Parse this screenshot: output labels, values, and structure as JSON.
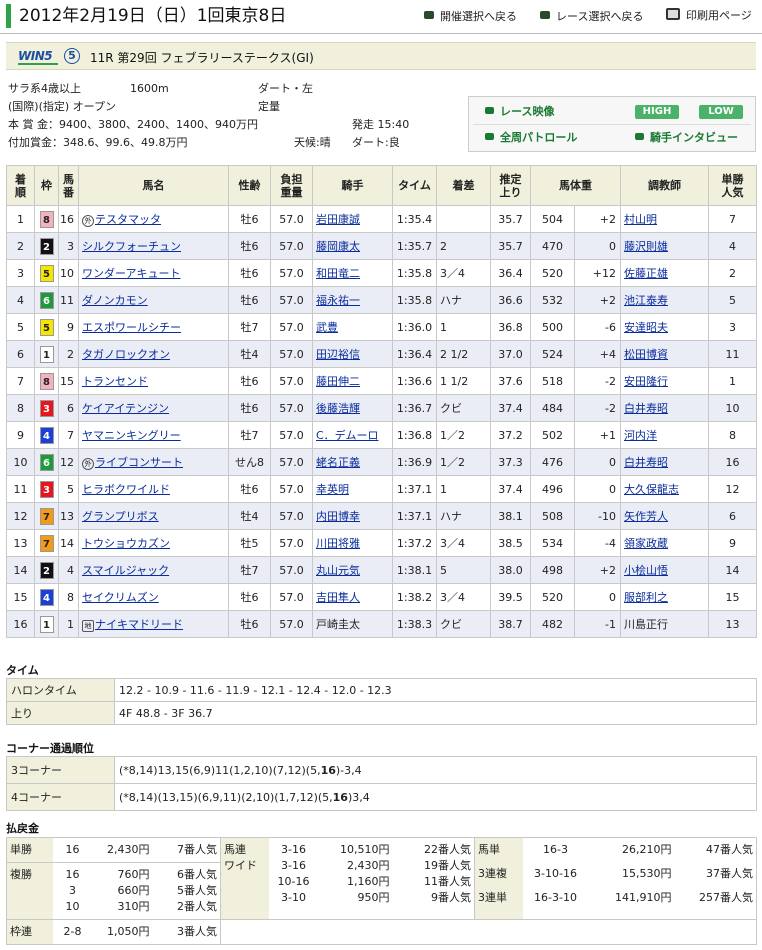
{
  "header": {
    "title": "2012年2月19日（日）1回東京8日",
    "links": {
      "kaisai": "開催選択へ戻る",
      "race": "レース選択へ戻る",
      "print": "印刷用ページ"
    }
  },
  "race_bar": {
    "logo": "WIN5",
    "win5_number": "⑤",
    "race_name": "11R 第29回 フェブラリーステークス(GI)"
  },
  "info": {
    "class": "サラ系4歳以上",
    "distance": "1600m",
    "surface": "ダート・左",
    "condition_label": "(国際)(指定) オープン",
    "weight_rule": "定量",
    "prize": "本 賞 金：9400、3800、2400、1400、940万円",
    "added_prize": "付加賞金：348.6、99.6、49.8万円",
    "post_time": "発走 15:40",
    "weather": "天候:晴",
    "track": "ダート:良"
  },
  "media": {
    "race_video": "レース映像",
    "high": "HIGH",
    "low": "LOW",
    "patrol": "全周パトロール",
    "interview": "騎手インタビュー"
  },
  "results_header": {
    "rank": [
      "着",
      "順"
    ],
    "waku": "枠",
    "num": [
      "馬",
      "番"
    ],
    "horse": "馬名",
    "sexage": "性齢",
    "weight": [
      "負担",
      "重量"
    ],
    "jockey": "騎手",
    "time": "タイム",
    "margin": "着差",
    "last3f": [
      "推定",
      "上り"
    ],
    "body": "馬体重",
    "trainer": "調教師",
    "pop": [
      "単勝",
      "人気"
    ]
  },
  "results": [
    {
      "rank": "1",
      "waku": "8",
      "num": "16",
      "mark": "外",
      "horse": "テスタマッタ",
      "sexage": "牡6",
      "weight": "57.0",
      "jockey": "岩田康誠",
      "time": "1:35.4",
      "margin": "",
      "last3f": "35.7",
      "body": "504",
      "diff": "+2",
      "trainer": "村山明",
      "pop": "7"
    },
    {
      "rank": "2",
      "waku": "2",
      "num": "3",
      "mark": "",
      "horse": "シルクフォーチュン",
      "sexage": "牡6",
      "weight": "57.0",
      "jockey": "藤岡康太",
      "time": "1:35.7",
      "margin": "2",
      "last3f": "35.7",
      "body": "470",
      "diff": "0",
      "trainer": "藤沢則雄",
      "pop": "4"
    },
    {
      "rank": "3",
      "waku": "5",
      "num": "10",
      "mark": "",
      "horse": "ワンダーアキュート",
      "sexage": "牡6",
      "weight": "57.0",
      "jockey": "和田竜二",
      "time": "1:35.8",
      "margin": "3／4",
      "last3f": "36.4",
      "body": "520",
      "diff": "+12",
      "trainer": "佐藤正雄",
      "pop": "2"
    },
    {
      "rank": "4",
      "waku": "6",
      "num": "11",
      "mark": "",
      "horse": "ダノンカモン",
      "sexage": "牡6",
      "weight": "57.0",
      "jockey": "福永祐一",
      "time": "1:35.8",
      "margin": "ハナ",
      "last3f": "36.6",
      "body": "532",
      "diff": "+2",
      "trainer": "池江泰寿",
      "pop": "5"
    },
    {
      "rank": "5",
      "waku": "5",
      "num": "9",
      "mark": "",
      "horse": "エスポワールシチー",
      "sexage": "牡7",
      "weight": "57.0",
      "jockey": "武豊",
      "time": "1:36.0",
      "margin": "1",
      "last3f": "36.8",
      "body": "500",
      "diff": "-6",
      "trainer": "安達昭夫",
      "pop": "3"
    },
    {
      "rank": "6",
      "waku": "1",
      "num": "2",
      "mark": "",
      "horse": "タガノロックオン",
      "sexage": "牡4",
      "weight": "57.0",
      "jockey": "田辺裕信",
      "time": "1:36.4",
      "margin": "2 1/2",
      "last3f": "37.0",
      "body": "524",
      "diff": "+4",
      "trainer": "松田博資",
      "pop": "11"
    },
    {
      "rank": "7",
      "waku": "8",
      "num": "15",
      "mark": "",
      "horse": "トランセンド",
      "sexage": "牡6",
      "weight": "57.0",
      "jockey": "藤田伸二",
      "time": "1:36.6",
      "margin": "1 1/2",
      "last3f": "37.6",
      "body": "518",
      "diff": "-2",
      "trainer": "安田隆行",
      "pop": "1"
    },
    {
      "rank": "8",
      "waku": "3",
      "num": "6",
      "mark": "",
      "horse": "ケイアイテンジン",
      "sexage": "牡6",
      "weight": "57.0",
      "jockey": "後藤浩輝",
      "time": "1:36.7",
      "margin": "クビ",
      "last3f": "37.4",
      "body": "484",
      "diff": "-2",
      "trainer": "白井寿昭",
      "pop": "10"
    },
    {
      "rank": "9",
      "waku": "4",
      "num": "7",
      "mark": "",
      "horse": "ヤマニンキングリー",
      "sexage": "牡7",
      "weight": "57.0",
      "jockey": "C．デムーロ",
      "time": "1:36.8",
      "margin": "1／2",
      "last3f": "37.2",
      "body": "502",
      "diff": "+1",
      "trainer": "河内洋",
      "pop": "8"
    },
    {
      "rank": "10",
      "waku": "6",
      "num": "12",
      "mark": "外",
      "horse": "ライブコンサート",
      "sexage": "せん8",
      "weight": "57.0",
      "jockey": "蛯名正義",
      "time": "1:36.9",
      "margin": "1／2",
      "last3f": "37.3",
      "body": "476",
      "diff": "0",
      "trainer": "白井寿昭",
      "pop": "16"
    },
    {
      "rank": "11",
      "waku": "3",
      "num": "5",
      "mark": "",
      "horse": "ヒラボクワイルド",
      "sexage": "牡6",
      "weight": "57.0",
      "jockey": "幸英明",
      "time": "1:37.1",
      "margin": "1",
      "last3f": "37.4",
      "body": "496",
      "diff": "0",
      "trainer": "大久保龍志",
      "pop": "12"
    },
    {
      "rank": "12",
      "waku": "7",
      "num": "13",
      "mark": "",
      "horse": "グランプリボス",
      "sexage": "牡4",
      "weight": "57.0",
      "jockey": "内田博幸",
      "time": "1:37.1",
      "margin": "ハナ",
      "last3f": "38.1",
      "body": "508",
      "diff": "-10",
      "trainer": "矢作芳人",
      "pop": "6"
    },
    {
      "rank": "13",
      "waku": "7",
      "num": "14",
      "mark": "",
      "horse": "トウショウカズン",
      "sexage": "牡5",
      "weight": "57.0",
      "jockey": "川田将雅",
      "time": "1:37.2",
      "margin": "3／4",
      "last3f": "38.5",
      "body": "534",
      "diff": "-4",
      "trainer": "領家政蔵",
      "pop": "9"
    },
    {
      "rank": "14",
      "waku": "2",
      "num": "4",
      "mark": "",
      "horse": "スマイルジャック",
      "sexage": "牡7",
      "weight": "57.0",
      "jockey": "丸山元気",
      "time": "1:38.1",
      "margin": "5",
      "last3f": "38.0",
      "body": "498",
      "diff": "+2",
      "trainer": "小桧山悟",
      "pop": "14"
    },
    {
      "rank": "15",
      "waku": "4",
      "num": "8",
      "mark": "",
      "horse": "セイクリムズン",
      "sexage": "牡6",
      "weight": "57.0",
      "jockey": "吉田隼人",
      "time": "1:38.2",
      "margin": "3／4",
      "last3f": "39.5",
      "body": "520",
      "diff": "0",
      "trainer": "服部利之",
      "pop": "15"
    },
    {
      "rank": "16",
      "waku": "1",
      "num": "1",
      "mark": "地",
      "horse": "ナイキマドリード",
      "sexage": "牡6",
      "weight": "57.0",
      "jockey": "戸崎圭太",
      "time": "1:38.3",
      "margin": "クビ",
      "last3f": "38.7",
      "body": "482",
      "diff": "-1",
      "trainer": "川島正行",
      "pop": "13"
    }
  ],
  "waku_colors": {
    "1": {
      "bg": "#ffffff",
      "fg": "#222222"
    },
    "2": {
      "bg": "#111111",
      "fg": "#ffffff"
    },
    "3": {
      "bg": "#e8141e",
      "fg": "#ffffff"
    },
    "4": {
      "bg": "#1c3fd8",
      "fg": "#ffffff"
    },
    "5": {
      "bg": "#f5e600",
      "fg": "#222222"
    },
    "6": {
      "bg": "#1e9a3c",
      "fg": "#ffffff"
    },
    "7": {
      "bg": "#f29a1a",
      "fg": "#222222"
    },
    "8": {
      "bg": "#f4b2bf",
      "fg": "#222222"
    }
  },
  "time_section": {
    "title": "タイム",
    "halon_label": "ハロンタイム",
    "halon": "12.2 - 10.9 - 11.6 - 11.9 - 12.1 - 12.4 - 12.0 - 12.3",
    "agari_label": "上り",
    "agari": "4F 48.8 - 3F 36.7"
  },
  "corner_section": {
    "title": "コーナー通過順位",
    "c3_label": "3コーナー",
    "c3_pre": "(*8,14)13,15(6,9)11(1,2,10)(7,12)(5,",
    "c3_bold": "16",
    "c3_post": ")-3,4",
    "c4_label": "4コーナー",
    "c4_pre": "(*8,14)(13,15)(6,9,11)(2,10)(1,7,12)(5,",
    "c4_bold": "16",
    "c4_post": ")3,4"
  },
  "payout_section": {
    "title": "払戻金",
    "tansho": {
      "label": "単勝",
      "rows": [
        {
          "combo": "16",
          "yen": "2,430円",
          "pop": "7番人気"
        }
      ]
    },
    "fukusho": {
      "label": "複勝",
      "rows": [
        {
          "combo": "16",
          "yen": "760円",
          "pop": "6番人気"
        },
        {
          "combo": "3",
          "yen": "660円",
          "pop": "5番人気"
        },
        {
          "combo": "10",
          "yen": "310円",
          "pop": "2番人気"
        }
      ]
    },
    "wakuren": {
      "label": "枠連",
      "rows": [
        {
          "combo": "2-8",
          "yen": "1,050円",
          "pop": "3番人気"
        }
      ]
    },
    "umaren": {
      "label": "馬連",
      "rows": [
        {
          "combo": "3-16",
          "yen": "10,510円",
          "pop": "22番人気"
        }
      ]
    },
    "wide": {
      "label": "ワイド",
      "rows": [
        {
          "combo": "3-16",
          "yen": "2,430円",
          "pop": "19番人気"
        },
        {
          "combo": "10-16",
          "yen": "1,160円",
          "pop": "11番人気"
        },
        {
          "combo": "3-10",
          "yen": "950円",
          "pop": "9番人気"
        }
      ]
    },
    "umatan": {
      "label": "馬単",
      "rows": [
        {
          "combo": "16-3",
          "yen": "26,210円",
          "pop": "47番人気"
        }
      ]
    },
    "sanrenpuku": {
      "label": "3連複",
      "rows": [
        {
          "combo": "3-10-16",
          "yen": "15,530円",
          "pop": "37番人気"
        }
      ]
    },
    "sanrentan": {
      "label": "3連単",
      "rows": [
        {
          "combo": "16-3-10",
          "yen": "141,910円",
          "pop": "257番人気"
        }
      ]
    }
  }
}
